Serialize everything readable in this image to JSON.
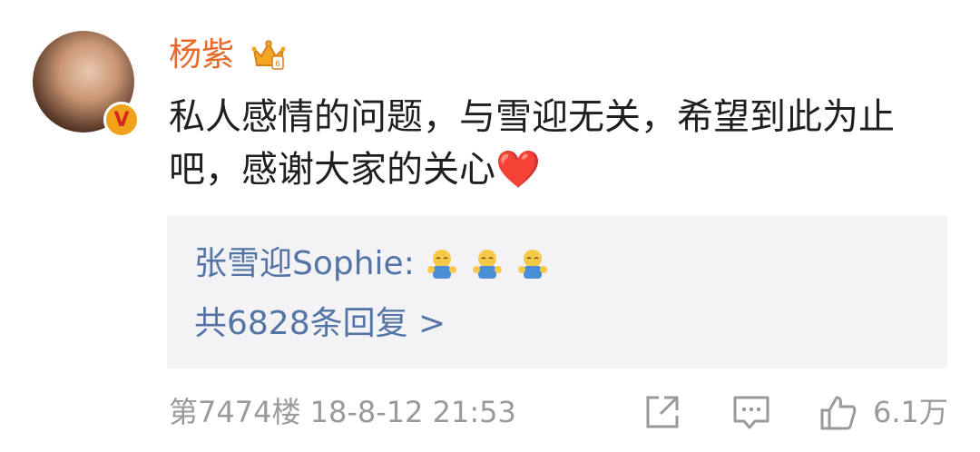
{
  "post": {
    "username": "杨紫",
    "badge": "V",
    "content": "私人感情的问题，与雪迎无关，希望到此为止吧，感谢大家的关心",
    "heart_emoji": "❤️",
    "reply": {
      "author": "张雪迎Sophie:",
      "emojis": [
        "hug-emoji",
        "hug-emoji",
        "hug-emoji"
      ],
      "count_text": "共6828条回复 >"
    },
    "meta": {
      "floor_time": "第7474楼 18-8-12 21:53",
      "like_count": "6.1万"
    }
  },
  "icons": [
    "crown-icon",
    "share-icon",
    "comment-icon",
    "like-icon"
  ],
  "colors": {
    "username": "#e86a2b",
    "link": "#5474a6",
    "meta": "#9a9a9a",
    "reply_bg": "#f3f3f5",
    "badge": "#f1a21b"
  }
}
